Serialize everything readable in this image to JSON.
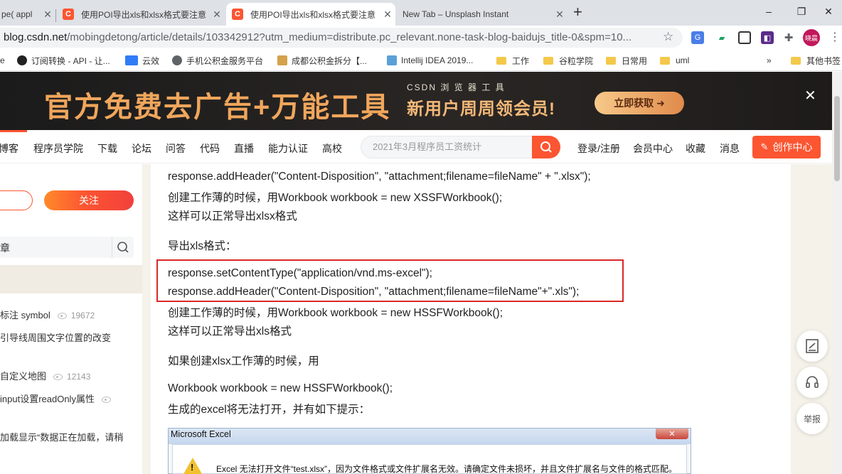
{
  "tabs": [
    {
      "title": "pe( appl",
      "close": "✕"
    },
    {
      "title": "使用POI导出xls和xlsx格式要注意",
      "close": "✕"
    },
    {
      "title": "使用POI导出xls和xlsx格式要注意",
      "close": "✕"
    },
    {
      "title": "New Tab – Unsplash Instant",
      "close": "✕"
    }
  ],
  "new_tab": "+",
  "window": {
    "minimize": "–",
    "restore": "❐",
    "close": "✕"
  },
  "url": {
    "host": "blog.csdn.net",
    "path": "/mobingdetong/article/details/103342912?utm_medium=distribute.pc_relevant.none-task-blog-baidujs_title-0&spm=10..."
  },
  "profile": "晓晨",
  "bookmarks": [
    "e",
    "订阅转换 - API - 让...",
    "云效",
    "手机公积金服务平台",
    "成都公积金拆分【...",
    "Intellij IDEA 2019...",
    "工作",
    "谷粒学院",
    "日常用",
    "uml",
    "»",
    "其他书签"
  ],
  "ad": {
    "headline": "官方免费去广告+万能工具",
    "brand": "CSDN 浏 览 器 工 具",
    "sub": "新用户周周领会员!",
    "button": "立即获取 ➜",
    "close": "✕"
  },
  "nav": {
    "items": [
      "博客",
      "程序员学院",
      "下载",
      "论坛",
      "问答",
      "代码",
      "直播",
      "能力认证",
      "高校"
    ],
    "search_placeholder": "2021年3月程序员工资统计",
    "right": [
      "登录/注册",
      "会员中心",
      "收藏",
      "消息"
    ],
    "create": "创作中心"
  },
  "sidebar": {
    "follow": "关注",
    "search_text": "章",
    "items": [
      {
        "text": "标注 symbol",
        "views": "19672"
      },
      {
        "text": "引导线周围文字位置的改变",
        "views": ""
      },
      {
        "text": "自定义地图",
        "views": "12143"
      },
      {
        "text": "input设置readOnly属性",
        "views": ""
      },
      {
        "text": "加载显示“数据正在加载，请稍",
        "views": ""
      }
    ]
  },
  "article": {
    "lines": [
      " response.addHeader(\"Content-Disposition\", \"attachment;filename=fileName\" + \".xlsx\");",
      "创建工作薄的时候，用Workbook workbook = new XSSFWorkbook();",
      "这样可以正常导出xlsx格式",
      "导出xls格式：",
      " response.setContentType(\"application/vnd.ms-excel\");",
      "  response.addHeader(\"Content-Disposition\", \"attachment;filename=fileName\"+\".xls\");",
      "创建工作薄的时候，用Workbook workbook = new HSSFWorkbook();",
      "这样可以正常导出xls格式",
      "如果创建xlsx工作薄的时候，用",
      "Workbook workbook = new HSSFWorkbook();",
      "生成的excel将无法打开，并有如下提示："
    ]
  },
  "excel": {
    "title": "Microsoft Excel",
    "close": "✕",
    "warn": "!",
    "message": "Excel 无法打开文件“test.xlsx”，因为文件格式或文件扩展名无效。请确定文件未损坏，并且文件扩展名与文件的格式匹配。"
  },
  "float": {
    "report": "举报"
  }
}
